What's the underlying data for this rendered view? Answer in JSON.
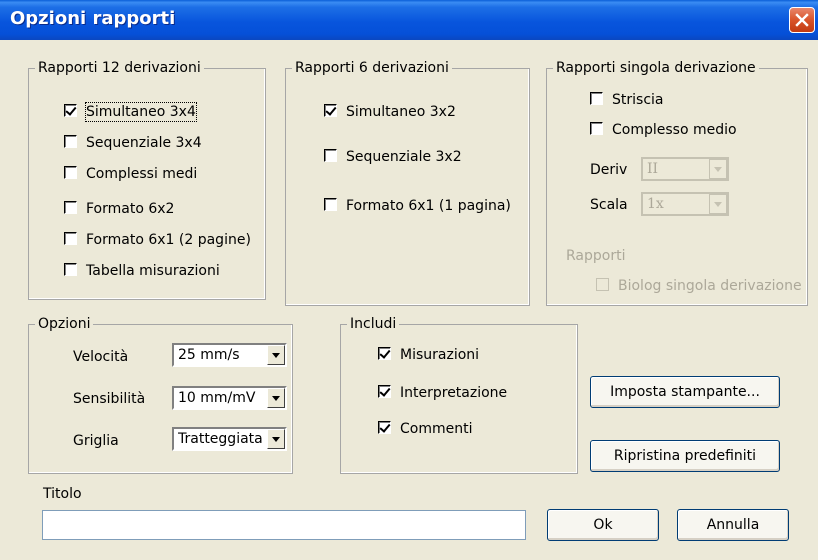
{
  "window": {
    "title": "Opzioni rapporti"
  },
  "groups": {
    "rapporti12": {
      "legend": "Rapporti 12 derivazioni",
      "items": [
        {
          "label": "Simultaneo 3x4",
          "checked": true
        },
        {
          "label": "Sequenziale 3x4",
          "checked": false
        },
        {
          "label": "Complessi medi",
          "checked": false
        },
        {
          "label": "Formato 6x2",
          "checked": false
        },
        {
          "label": "Formato 6x1 (2 pagine)",
          "checked": false
        },
        {
          "label": "Tabella misurazioni",
          "checked": false
        }
      ]
    },
    "rapporti6": {
      "legend": "Rapporti 6 derivazioni",
      "items": [
        {
          "label": "Simultaneo 3x2",
          "checked": true
        },
        {
          "label": "Sequenziale 3x2",
          "checked": false
        },
        {
          "label": "Formato 6x1 (1 pagina)",
          "checked": false
        }
      ]
    },
    "singola": {
      "legend": "Rapporti singola derivazione",
      "striscia": {
        "label": "Striscia",
        "checked": false
      },
      "complesso": {
        "label": "Complesso medio",
        "checked": false
      },
      "deriv_label": "Deriv",
      "deriv_value": "II",
      "scala_label": "Scala",
      "scala_value": "1x",
      "rapporti_label": "Rapporti",
      "biolog": {
        "label": "Biolog singola derivazione",
        "checked": false
      }
    },
    "opzioni": {
      "legend": "Opzioni",
      "velocita_label": "Velocità",
      "velocita_value": "25 mm/s",
      "sensibilita_label": "Sensibilità",
      "sensibilita_value": "10 mm/mV",
      "griglia_label": "Griglia",
      "griglia_value": "Tratteggiata"
    },
    "includi": {
      "legend": "Includi",
      "items": [
        {
          "label": "Misurazioni",
          "checked": true
        },
        {
          "label": "Interpretazione",
          "checked": true
        },
        {
          "label": "Commenti",
          "checked": true
        }
      ]
    }
  },
  "buttons": {
    "imposta": "Imposta stampante...",
    "ripristina": "Ripristina predefiniti",
    "ok": "Ok",
    "annulla": "Annulla"
  },
  "titolo": {
    "label": "Titolo",
    "value": ""
  }
}
